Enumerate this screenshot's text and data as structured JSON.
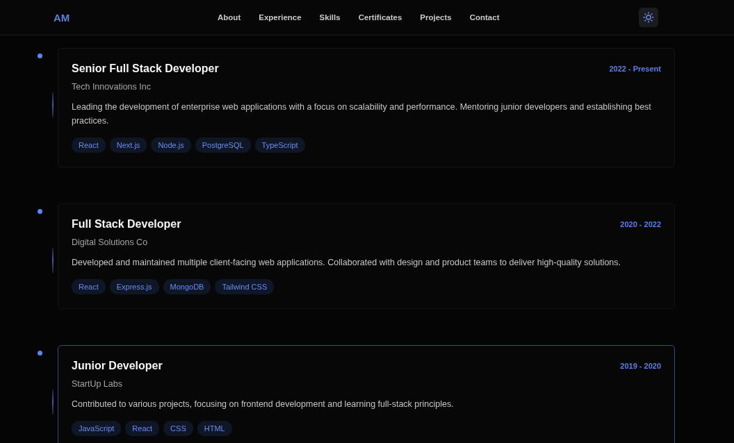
{
  "logo": "AM",
  "nav": [
    {
      "label": "About"
    },
    {
      "label": "Experience"
    },
    {
      "label": "Skills"
    },
    {
      "label": "Certificates"
    },
    {
      "label": "Projects"
    },
    {
      "label": "Contact"
    }
  ],
  "experience": [
    {
      "title": "Senior Full Stack Developer",
      "company": "Tech Innovations Inc",
      "period": "2022 - Present",
      "description": "Leading the development of enterprise web applications with a focus on scalability and performance. Mentoring junior developers and establishing best practices.",
      "tags": [
        "React",
        "Next.js",
        "Node.js",
        "PostgreSQL",
        "TypeScript"
      ],
      "highlighted": false
    },
    {
      "title": "Full Stack Developer",
      "company": "Digital Solutions Co",
      "period": "2020 - 2022",
      "description": "Developed and maintained multiple client-facing web applications. Collaborated with design and product teams to deliver high-quality solutions.",
      "tags": [
        "React",
        "Express.js",
        "MongoDB",
        "Tailwind CSS"
      ],
      "highlighted": false
    },
    {
      "title": "Junior Developer",
      "company": "StartUp Labs",
      "period": "2019 - 2020",
      "description": "Contributed to various projects, focusing on frontend development and learning full-stack principles.",
      "tags": [
        "JavaScript",
        "React",
        "CSS",
        "HTML"
      ],
      "highlighted": true
    }
  ]
}
